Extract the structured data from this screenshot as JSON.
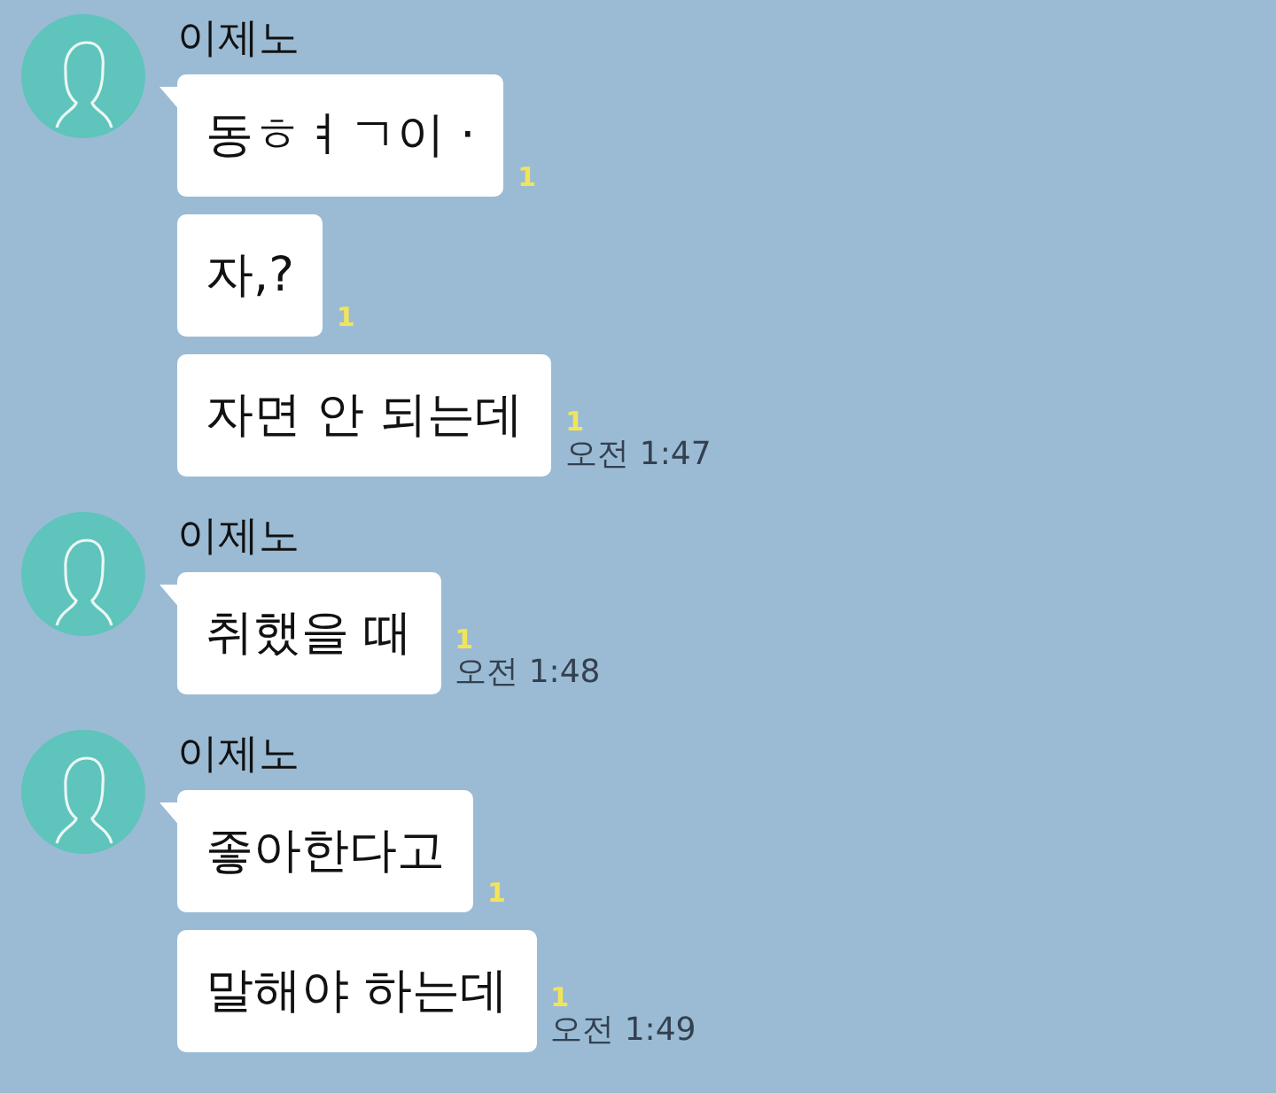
{
  "groups": [
    {
      "sender": "이제노",
      "messages": [
        {
          "text": "동ㅎㅕㄱ이 ·",
          "unread": "1"
        },
        {
          "text": "자,?",
          "unread": "1"
        },
        {
          "text": "자면 안 되는데",
          "unread": "1",
          "time": "오전 1:47"
        }
      ]
    },
    {
      "sender": "이제노",
      "messages": [
        {
          "text": "취했을 때",
          "unread": "1",
          "time": "오전 1:48"
        }
      ]
    },
    {
      "sender": "이제노",
      "messages": [
        {
          "text": "좋아한다고",
          "unread": "1"
        },
        {
          "text": "말해야 하는데",
          "unread": "1",
          "time": "오전 1:49"
        }
      ]
    }
  ]
}
